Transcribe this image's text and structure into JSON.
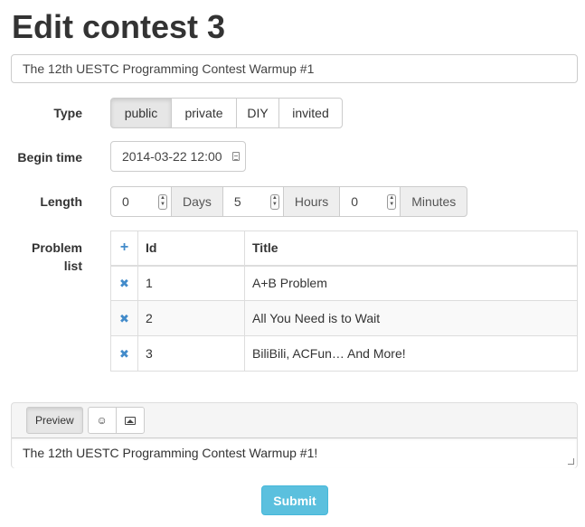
{
  "page": {
    "title": "Edit contest 3"
  },
  "contest": {
    "title_value": "The 12th UESTC Programming Contest Warmup #1"
  },
  "type": {
    "label": "Type",
    "options": [
      "public",
      "private",
      "DIY",
      "invited"
    ],
    "selected": "public"
  },
  "begin": {
    "label": "Begin time",
    "value": "2014-03-22 12:00",
    "icon": "calendar-icon"
  },
  "length": {
    "label": "Length",
    "days": {
      "value": "0",
      "unit": "Days"
    },
    "hours": {
      "value": "5",
      "unit": "Hours"
    },
    "minutes": {
      "value": "0",
      "unit": "Minutes"
    }
  },
  "problems": {
    "label_line1": "Problem",
    "label_line2": "list",
    "add_icon": "+",
    "headers": {
      "id": "Id",
      "title": "Title"
    },
    "remove_icon": "✖",
    "rows": [
      {
        "id": "1",
        "title": "A+B Problem"
      },
      {
        "id": "2",
        "title": "All You Need is to Wait"
      },
      {
        "id": "3",
        "title": "BiliBili, ACFun… And More!"
      }
    ]
  },
  "editor": {
    "preview_label": "Preview",
    "emoji_icon": "☺",
    "image_icon": "image-icon",
    "content": "The 12th UESTC Programming Contest Warmup #1!"
  },
  "submit_label": "Submit",
  "colors": {
    "accent": "#428bca",
    "submit": "#5bc0de"
  }
}
